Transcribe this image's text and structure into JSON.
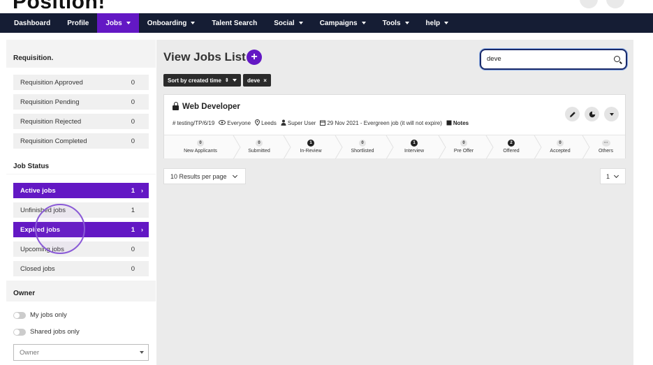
{
  "app": {
    "logo_text": "Position!"
  },
  "nav": {
    "items": [
      {
        "label": "Dashboard",
        "has_caret": false,
        "active": false
      },
      {
        "label": "Profile",
        "has_caret": false,
        "active": false
      },
      {
        "label": "Jobs",
        "has_caret": true,
        "active": true
      },
      {
        "label": "Onboarding",
        "has_caret": true,
        "active": false
      },
      {
        "label": "Talent Search",
        "has_caret": false,
        "active": false
      },
      {
        "label": "Social",
        "has_caret": true,
        "active": false
      },
      {
        "label": "Campaigns",
        "has_caret": true,
        "active": false
      },
      {
        "label": "Tools",
        "has_caret": true,
        "active": false
      },
      {
        "label": "help",
        "has_caret": true,
        "active": false
      }
    ]
  },
  "sidebar": {
    "requisition_title": "Requisition.",
    "requisition": [
      {
        "label": "Requisition Approved",
        "count": "0"
      },
      {
        "label": "Requisition Pending",
        "count": "0"
      },
      {
        "label": "Requisition Rejected",
        "count": "0"
      },
      {
        "label": "Requisition Completed",
        "count": "0"
      }
    ],
    "job_status_title": "Job Status",
    "job_status": [
      {
        "label": "Active jobs",
        "count": "1",
        "active": true
      },
      {
        "label": "Unfinished jobs",
        "count": "1",
        "active": false
      },
      {
        "label": "Expired jobs",
        "count": "1",
        "active": true
      },
      {
        "label": "Upcoming jobs",
        "count": "0",
        "active": false
      },
      {
        "label": "Closed jobs",
        "count": "0",
        "active": false
      }
    ],
    "owner_title": "Owner",
    "my_jobs_label": "My jobs only",
    "shared_jobs_label": "Shared jobs only",
    "owner_placeholder": "Owner"
  },
  "main": {
    "title": "View Jobs List",
    "add_symbol": "+",
    "search_value": "deve",
    "sort_chip": "Sort by created time",
    "filter_chip": "deve",
    "per_page": "10 Results per page",
    "page": "1"
  },
  "job": {
    "title": "Web Developer",
    "reference": "testing/TP/6/19",
    "visibility": "Everyone",
    "location": "Leeds",
    "owner": "Super User",
    "date": "29 Nov 2021 - Evergreen job (it will not expire)",
    "notes": "Notes",
    "pipeline": [
      {
        "label": "New Applicants",
        "count": "0"
      },
      {
        "label": "Submitted",
        "count": "0"
      },
      {
        "label": "In-Review",
        "count": "1"
      },
      {
        "label": "Shortlisted",
        "count": "0"
      },
      {
        "label": "Interview",
        "count": "1"
      },
      {
        "label": "Pre Offer",
        "count": "0"
      },
      {
        "label": "Offered",
        "count": "2"
      },
      {
        "label": "Accepted",
        "count": "0"
      },
      {
        "label": "Others",
        "count": "···"
      }
    ]
  },
  "colors": {
    "accent": "#6318c4",
    "nav_bg": "#151d34"
  },
  "icons": [
    "lock-icon",
    "hash-icon",
    "eye-icon",
    "map-pin-icon",
    "user-icon",
    "calendar-icon",
    "note-icon",
    "pencil-icon",
    "pie-chart-icon",
    "caret-down-icon",
    "search-icon",
    "chevron-right-icon"
  ]
}
